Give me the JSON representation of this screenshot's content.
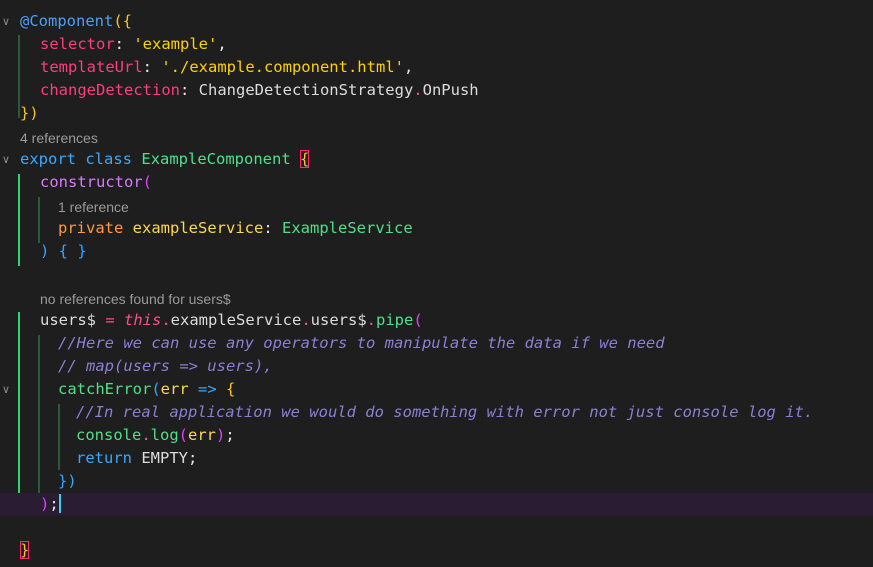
{
  "editor": {
    "language": "TypeScript",
    "colors": {
      "background": "#1e1e1e",
      "current_line": "#2a1c33",
      "decorator": "#4f9ef8",
      "property": "#ff3d7f",
      "string": "#ffd200",
      "keyword": "#38a8ff",
      "class_name": "#50e08a",
      "function": "#d77aff",
      "comment": "#8b7fd6",
      "codelens": "#9a9a9a",
      "indent_guide": "#2fd46f",
      "cursor": "#3ad0e8"
    },
    "code": {
      "l1_decorator": "@Component",
      "l1_open": "({",
      "l2_key": "selector",
      "l2_colon": ": ",
      "l2_value": "'example'",
      "l2_comma": ",",
      "l3_key": "templateUrl",
      "l3_colon": ": ",
      "l3_value": "'./example.component.html'",
      "l3_comma": ",",
      "l4_key": "changeDetection",
      "l4_colon": ": ",
      "l4_value_obj": "ChangeDetectionStrategy",
      "l4_dot": ".",
      "l4_value_prop": "OnPush",
      "l5_close": "})",
      "lens1": "4 references",
      "l6_export": "export",
      "l6_class": "class",
      "l6_name": "ExampleComponent",
      "l6_brace": "{",
      "l7_ctor": "constructor",
      "l7_paren": "(",
      "lens2": "1 reference",
      "l8_private": "private",
      "l8_param": "exampleService",
      "l8_colon": ": ",
      "l8_type": "ExampleService",
      "l9_close": ") { }",
      "lens3": "no references found for users$",
      "l10_var": "users$",
      "l10_eq": " = ",
      "l10_this": "this",
      "l10_dot1": ".",
      "l10_service": "exampleService",
      "l10_dot2": ".",
      "l10_users": "users$",
      "l10_dot3": ".",
      "l10_pipe": "pipe",
      "l10_paren": "(",
      "l11_comment": "//Here we can use any operators to manipulate the data if we need",
      "l12_comment": "// map(users => users),",
      "l13_fn": "catchError",
      "l13_paren": "(",
      "l13_param": "err",
      "l13_arrow": " => ",
      "l13_brace": "{",
      "l14_comment": "//In real application we would do something with error not just console log it.",
      "l15_console": "console",
      "l15_dot": ".",
      "l15_log": "log",
      "l15_open": "(",
      "l15_arg": "err",
      "l15_close": ")",
      "l15_semi": ";",
      "l16_return": "return",
      "l16_value": "EMPTY",
      "l16_semi": ";",
      "l17_close": "})",
      "l18_close": ")",
      "l18_semi": ";",
      "l20_close": "}"
    },
    "folding_icons": [
      "chevron-down-icon",
      "chevron-down-icon",
      "chevron-down-icon"
    ]
  }
}
